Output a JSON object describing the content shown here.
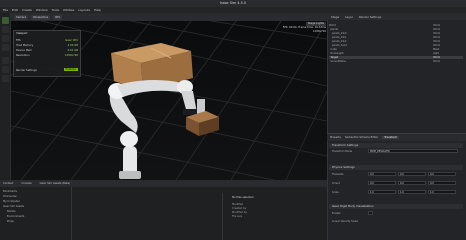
{
  "window": {
    "title": "Isaac Sim 4.5.0"
  },
  "menu": [
    "File",
    "Edit",
    "Create",
    "Window",
    "Tools",
    "Utilities",
    "Layouts",
    "Help"
  ],
  "viewport": {
    "toolbar": {
      "chip_1": "Camera",
      "chip_2": "Perspective",
      "chip_3": "RTX"
    },
    "hud": {
      "title": "Viewport",
      "fps_label": "FPS",
      "fps_value": "Isaac CPU",
      "mem_label": "Host Memory",
      "mem_value": "2.00 GB",
      "gpu_label": "Device Mem",
      "gpu_value": "0.61 GB",
      "res_label": "Resolution",
      "res_value": "1280x720",
      "mode_label": "Render Settings",
      "mode_value": "Enabled"
    },
    "stats": {
      "line_1": "Stage Lights",
      "line_2": "FPS: 60.00, Frame time: 16.67ms",
      "line_3": "1280x720"
    }
  },
  "right_panel": {
    "tabs": [
      "Stage",
      "Layer",
      "Render Settings"
    ],
    "stage_rows": [
      {
        "label": "World",
        "type": "Xform",
        "selected": false
      },
      {
        "label": "  panda",
        "type": "Xform",
        "selected": false
      },
      {
        "label": "    panda_link0",
        "type": "Xform",
        "selected": false
      },
      {
        "label": "    panda_link1",
        "type": "Xform",
        "selected": false
      },
      {
        "label": "    panda_link2",
        "type": "Xform",
        "selected": false
      },
      {
        "label": "    panda_hand",
        "type": "Xform",
        "selected": false
      },
      {
        "label": "  Cube",
        "type": "Mesh",
        "selected": false
      },
      {
        "label": "  DomeLight",
        "type": "Light",
        "selected": false
      },
      {
        "label": "  Target",
        "type": "Xform",
        "selected": true
      },
      {
        "label": "  GroundPlane",
        "type": "Xform",
        "selected": false
      }
    ],
    "properties": {
      "tabs": [
        "Property",
        "Semantics Schema Editor",
        "Transform"
      ],
      "active_tab": "Transform",
      "section_1": "Transform Settings",
      "label_1": "Transform Mode",
      "field_1": "PRIM_RESOLVED",
      "section_2": "Physics Settings",
      "label_2": "Translate",
      "label_3": "Orient",
      "label_4": "Scale",
      "vec_1": [
        "0.0",
        "0.0",
        "0.0"
      ],
      "vec_2": [
        "0.0",
        "0.0",
        "0.0"
      ],
      "vec_3": [
        "1.0",
        "1.0",
        "1.0"
      ],
      "section_3": "Isaac Rigid Body Visualization",
      "label_5": "Enable",
      "label_6": "Linear Velocity Scale"
    }
  },
  "bottom_panel": {
    "tabs": [
      "Content",
      "Console",
      "Isaac Sim Assets (Beta)"
    ],
    "folders": [
      "Bookmarks",
      "Omniverse",
      "My Computer",
      "Isaac Sim Assets",
      "Robots",
      "Environments",
      "Props"
    ],
    "info": {
      "title": "No files selected",
      "line_1": "Modified",
      "line_2": "Created by",
      "line_3": "Modified by",
      "line_4": "File size"
    }
  },
  "colors": {
    "accent": "#76b900",
    "background": "#1e1f21"
  }
}
